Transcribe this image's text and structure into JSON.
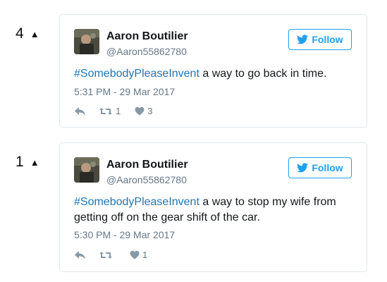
{
  "posts": [
    {
      "votes": "4",
      "vote_arrow": "▲",
      "author": "Aaron Boutilier",
      "handle": "@Aaron55862780",
      "follow_label": "Follow",
      "hashtag": "#SomebodyPleaseInvent",
      "text": " a way to go back in time.",
      "timestamp": "5:31 PM - 29 Mar 2017",
      "retweets": "1",
      "likes": "3"
    },
    {
      "votes": "1",
      "vote_arrow": "▲",
      "author": "Aaron Boutilier",
      "handle": "@Aaron55862780",
      "follow_label": "Follow",
      "hashtag": "#SomebodyPleaseInvent",
      "text": " a way to stop my wife from getting off on the gear shift of the car.",
      "timestamp": "5:30 PM - 29 Mar 2017",
      "retweets": "",
      "likes": "1"
    }
  ],
  "icons": {
    "vote": "triangle-up-icon",
    "follow": "bird-icon",
    "reply": "reply-icon",
    "retweet": "retweet-icon",
    "like": "heart-icon"
  },
  "colors": {
    "link": "#1b77b7",
    "brand": "#1da1f2",
    "muted": "#657786",
    "border": "#e1e8ed"
  }
}
